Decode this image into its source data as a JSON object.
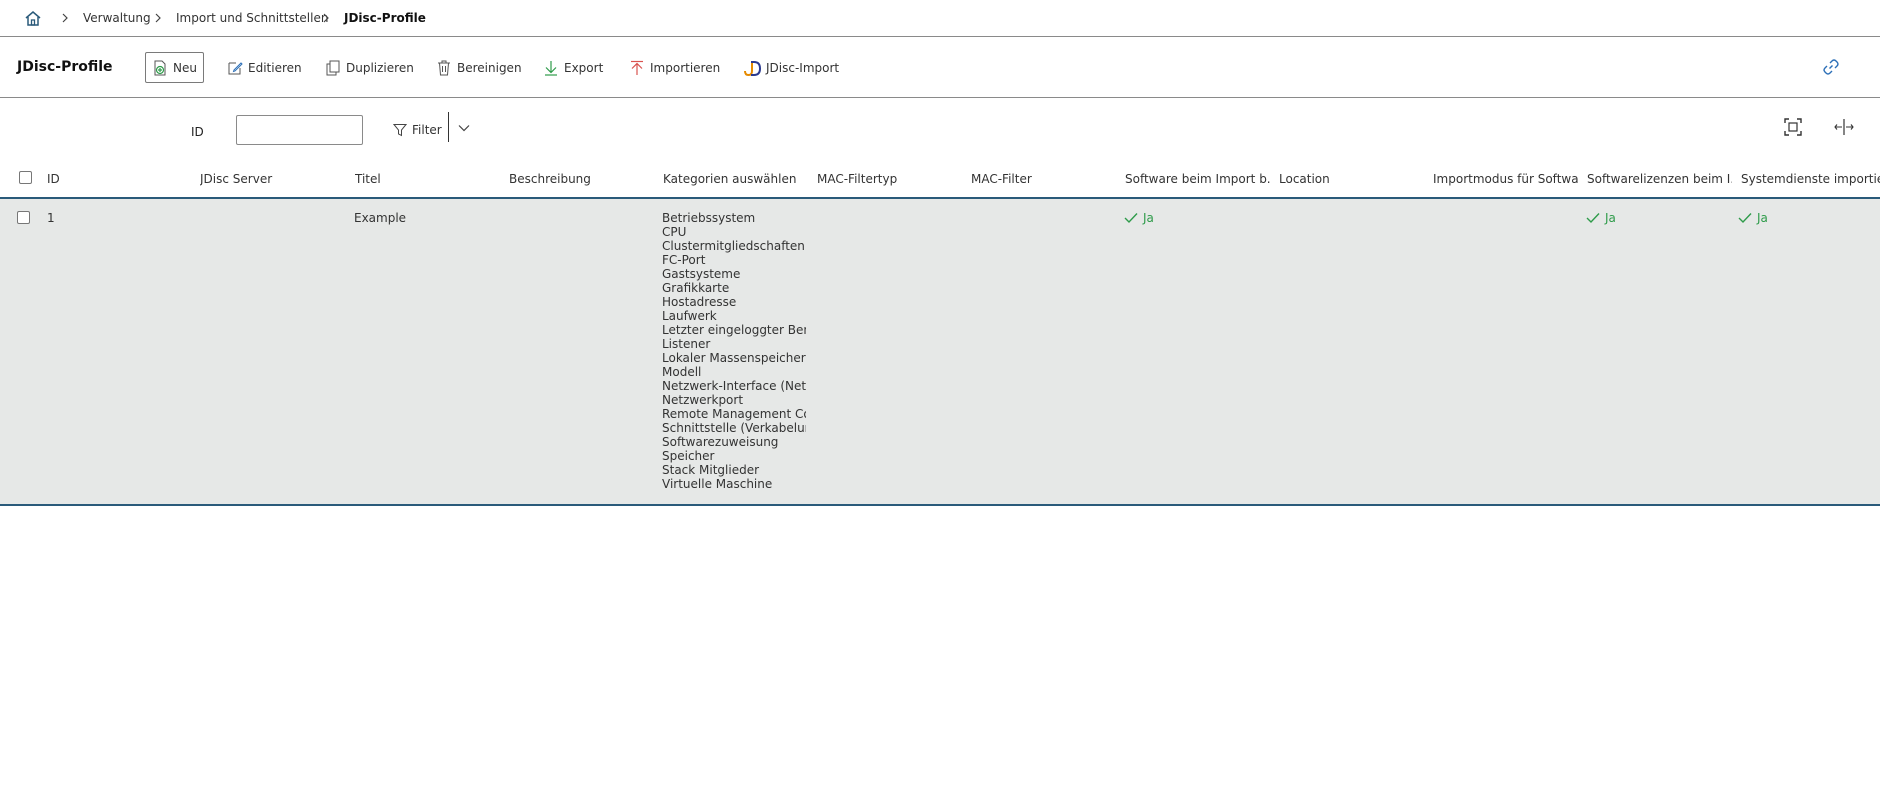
{
  "breadcrumb": {
    "items": [
      "Verwaltung",
      "Import und Schnittstellen"
    ],
    "current": "JDisc-Profile"
  },
  "toolbar": {
    "title": "JDisc-Profile",
    "buttons": {
      "new": "Neu",
      "edit": "Editieren",
      "duplicate": "Duplizieren",
      "purge": "Bereinigen",
      "export": "Export",
      "import": "Importieren",
      "jdisc_import": "JDisc-Import"
    }
  },
  "filter": {
    "id_label": "ID",
    "id_value": "",
    "filter_label": "Filter"
  },
  "table": {
    "columns": [
      "ID",
      "JDisc Server",
      "Titel",
      "Beschreibung",
      "Kategorien auswählen",
      "MAC-Filtertyp",
      "MAC-Filter",
      "Software beim Import b...",
      "Location",
      "Importmodus für Softwa...",
      "Softwarelizenzen beim I...",
      "Systemdienste importieren"
    ],
    "rows": [
      {
        "id": "1",
        "server": "",
        "title": "Example",
        "description": "",
        "categories": [
          "Betriebssystem",
          "CPU",
          "Clustermitgliedschaften",
          "FC-Port",
          "Gastsysteme",
          "Grafikkarte",
          "Hostadresse",
          "Laufwerk",
          "Letzter eingeloggter Benutzer",
          "Listener",
          "Lokaler Massenspeicher",
          "Modell",
          "Netzwerk-Interface (Netzwerk)",
          "Netzwerkport",
          "Remote Management Controller",
          "Schnittstelle (Verkabelung)",
          "Softwarezuweisung",
          "Speicher",
          "Stack Mitglieder",
          "Virtuelle Maschine"
        ],
        "mac_filter_type": "",
        "mac_filter": "",
        "software_import": "Ja",
        "location": "",
        "software_import_mode": "",
        "software_licenses": "Ja",
        "system_services": "Ja"
      }
    ]
  },
  "colors": {
    "accent": "#2a5a7a",
    "yes": "#2e9b4a",
    "row_bg": "#e6e8e7",
    "import_red": "#d9534f",
    "export_green": "#2e9b4a",
    "link_blue": "#2c6fb7"
  }
}
